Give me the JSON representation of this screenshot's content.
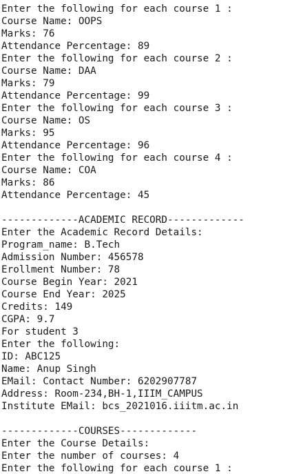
{
  "terminal": {
    "lines": [
      "Enter the following for each course 1 :",
      "Course Name: OOPS",
      "Marks: 76",
      "Attendance Percentage: 89",
      "Enter the following for each course 2 :",
      "Course Name: DAA",
      "Marks: 79",
      "Attendance Percentage: 99",
      "Enter the following for each course 3 :",
      "Course Name: OS",
      "Marks: 95",
      "Attendance Percentage: 96",
      "Enter the following for each course 4 :",
      "Course Name: COA",
      "Marks: 86",
      "Attendance Percentage: 45",
      "",
      "-------------ACADEMIC RECORD-------------",
      "Enter the Academic Record Details:",
      "Program_name: B.Tech",
      "Admission Number: 456578",
      "Erollment Number: 78",
      "Course Begin Year: 2021",
      "Course End Year: 2025",
      "Credits: 149",
      "CGPA: 9.7",
      "For student 3",
      "Enter the following:",
      "ID: ABC125",
      "Name: Anup Singh",
      "EMail: Contact Number: 6202907787",
      "Address: Room-234,BH-1,IIIM_CAMPUS",
      "Institute EMail: bcs_2021016.iiitm.ac.in",
      "",
      "-------------COURSES-------------",
      "Enter the Course Details:",
      "Enter the number of courses: 4",
      "Enter the following for each course 1 :"
    ]
  }
}
